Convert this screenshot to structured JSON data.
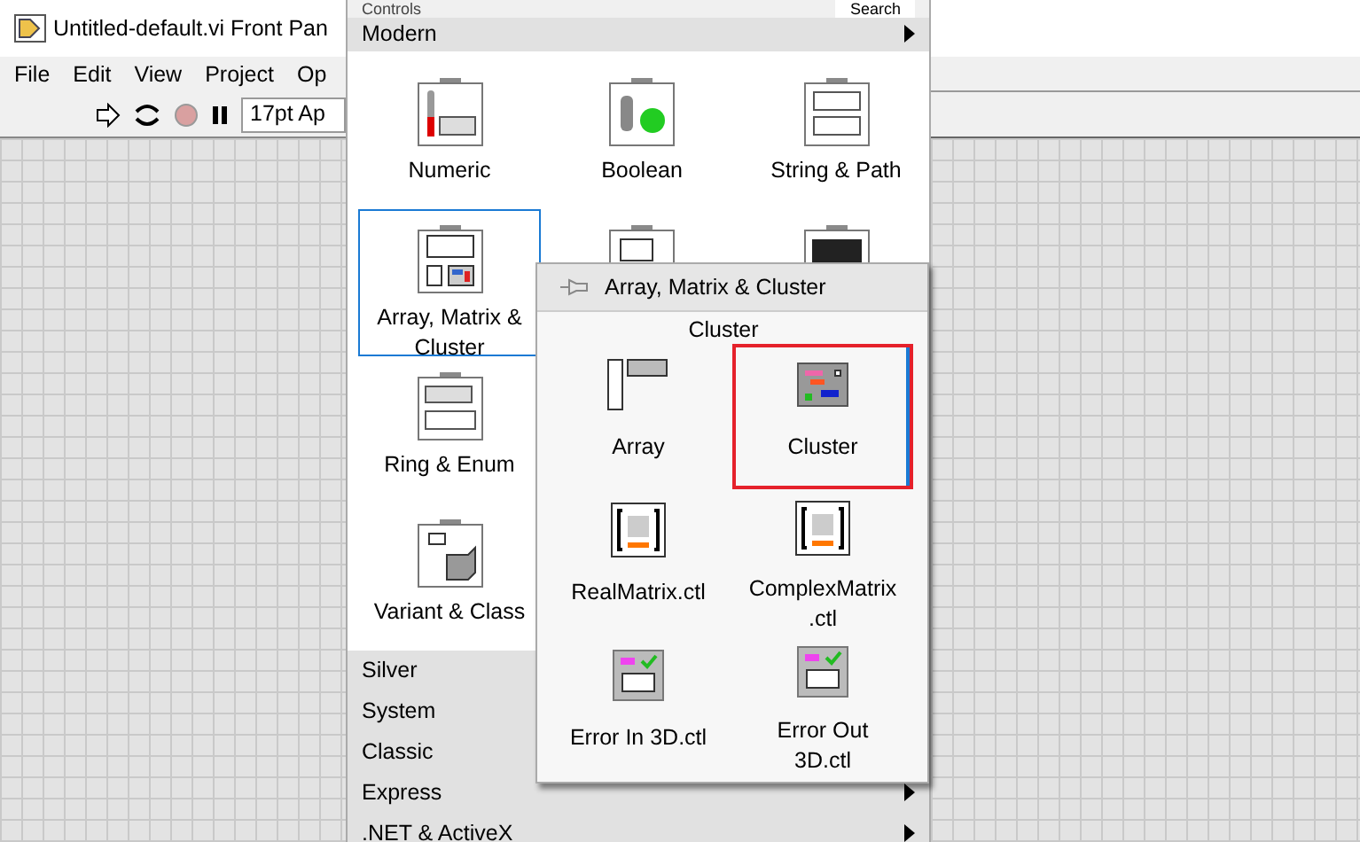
{
  "window": {
    "title": "Untitled-default.vi Front Pan"
  },
  "menu": [
    "File",
    "Edit",
    "View",
    "Project",
    "Op"
  ],
  "toolbar": {
    "font": "17pt Ap"
  },
  "palette": {
    "title": "Controls",
    "search": "Search",
    "section": "Modern",
    "items": [
      {
        "kind": "numeric",
        "label": "Numeric",
        "selected": false
      },
      {
        "kind": "boolean",
        "label": "Boolean",
        "selected": false
      },
      {
        "kind": "string_path",
        "label": "String & Path",
        "selected": false
      },
      {
        "kind": "array_cluster",
        "label": "Array, Matrix & Cluster",
        "selected": true
      },
      {
        "kind": "listbox",
        "selected": false
      },
      {
        "kind": "graph",
        "selected": false
      },
      {
        "kind": "ring_enum",
        "label": "Ring & Enum",
        "selected": false
      },
      {
        "kind": "variant_class",
        "label": "Variant & Class",
        "selected": false
      }
    ],
    "categories": [
      "Silver",
      "System",
      "Classic",
      "Express",
      ".NET & ActiveX"
    ]
  },
  "submenu": {
    "title": "Array, Matrix & Cluster",
    "hover_label": "Cluster",
    "items": [
      {
        "kind": "array",
        "label": "Array",
        "selected": false
      },
      {
        "kind": "cluster",
        "label": "Cluster",
        "selected": true
      },
      {
        "kind": "real_matrix",
        "label": "RealMatrix.ctl",
        "selected": false
      },
      {
        "kind": "complex_matrix",
        "label": "ComplexMatrix.ctl",
        "selected": false
      },
      {
        "kind": "error_in",
        "label": "Error In 3D.ctl",
        "selected": false
      },
      {
        "kind": "error_out",
        "label": "Error Out 3D.ctl",
        "selected": false
      }
    ]
  }
}
